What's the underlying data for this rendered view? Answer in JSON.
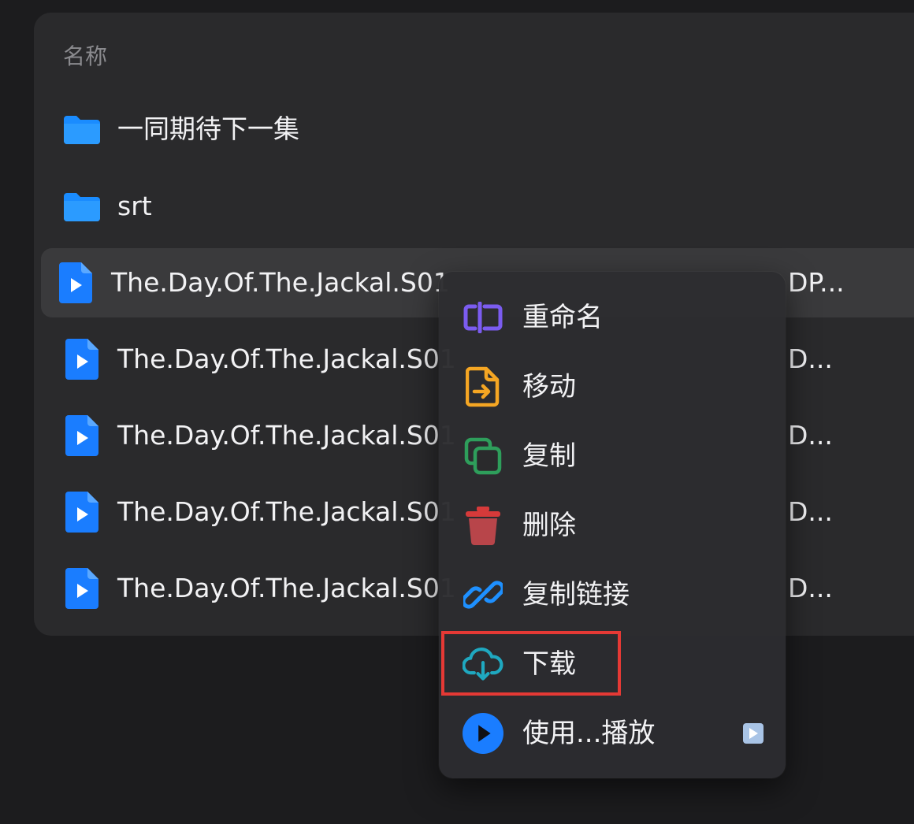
{
  "list": {
    "column_header": "名称",
    "rows": [
      {
        "type": "folder",
        "icon": "folder-icon",
        "name": "一同期待下一集",
        "tail": ""
      },
      {
        "type": "folder",
        "icon": "folder-icon",
        "name": "srt",
        "tail": ""
      },
      {
        "type": "video",
        "icon": "video-file-icon",
        "name": "The.Day.Of.The.Jackal.S01",
        "tail": "DP...",
        "selected": true
      },
      {
        "type": "video",
        "icon": "video-file-icon",
        "name": "The.Day.Of.The.Jackal.S01",
        "tail": "D..."
      },
      {
        "type": "video",
        "icon": "video-file-icon",
        "name": "The.Day.Of.The.Jackal.S01",
        "tail": "D..."
      },
      {
        "type": "video",
        "icon": "video-file-icon",
        "name": "The.Day.Of.The.Jackal.S01",
        "tail": "D..."
      },
      {
        "type": "video",
        "icon": "video-file-icon",
        "name": "The.Day.Of.The.Jackal.S01",
        "tail": "D..."
      }
    ]
  },
  "context_menu": {
    "items": [
      {
        "label": "重命名",
        "icon": "rename-icon",
        "color": "#7b5cf0"
      },
      {
        "label": "移动",
        "icon": "move-file-icon",
        "color": "#f5a623"
      },
      {
        "label": "复制",
        "icon": "copy-icon",
        "color": "#2e9e5b"
      },
      {
        "label": "删除",
        "icon": "trash-icon",
        "color": "#d63a3a"
      },
      {
        "label": "复制链接",
        "icon": "link-icon",
        "color": "#1e90ff"
      },
      {
        "label": "下载",
        "icon": "cloud-download-icon",
        "color": "#1fa8c0",
        "highlighted": true
      },
      {
        "label": "使用...播放",
        "icon": "play-circle-icon",
        "color": "#1a7dff",
        "has_submenu": true
      }
    ]
  },
  "colors": {
    "background": "#1c1c1e",
    "panel": "#2a2a2c",
    "selected_row": "#3a3a3c",
    "highlight": "#e53935",
    "file_blue": "#1a7dff"
  }
}
